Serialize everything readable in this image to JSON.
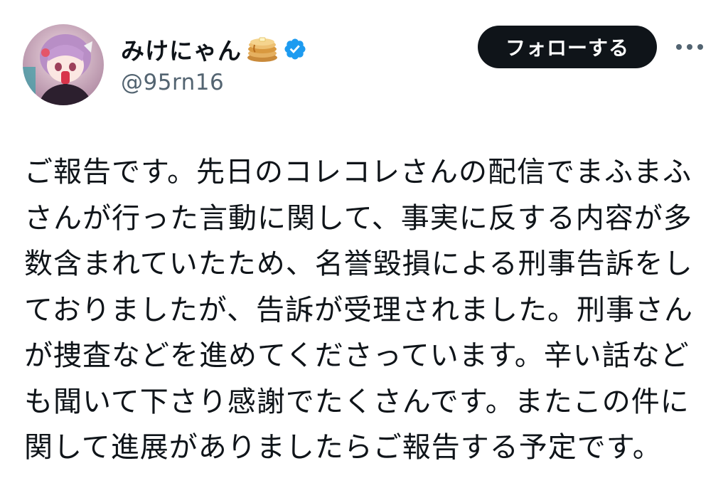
{
  "user": {
    "display_name": "みけにゃん",
    "handle": "@95rn16",
    "verified": true,
    "name_emoji_icon": "pancakes-icon",
    "verified_badge_color": "#1d9bf0"
  },
  "actions": {
    "follow_label": "フォローする",
    "more_icon": "more-horizontal-icon"
  },
  "tweet": {
    "lines": [
      "ご報告です。先日のコレコレさんの配信でまふまふ",
      "さんが行った言動に関して、事実に反する内容が多",
      "数含まれていたため、名誉毀損による刑事告訴をし",
      "ておりましたが、告訴が受理されました。刑事さん",
      "が捜査などを進めてくださっています。辛い話など",
      "も聞いて下さり感謝でたくさんです。またこの件に",
      "関して進展がありましたらご報告する予定です。"
    ]
  },
  "colors": {
    "text_primary": "#0f1419",
    "text_secondary": "#536471",
    "follow_button_bg": "#0f1419",
    "background": "#ffffff"
  }
}
